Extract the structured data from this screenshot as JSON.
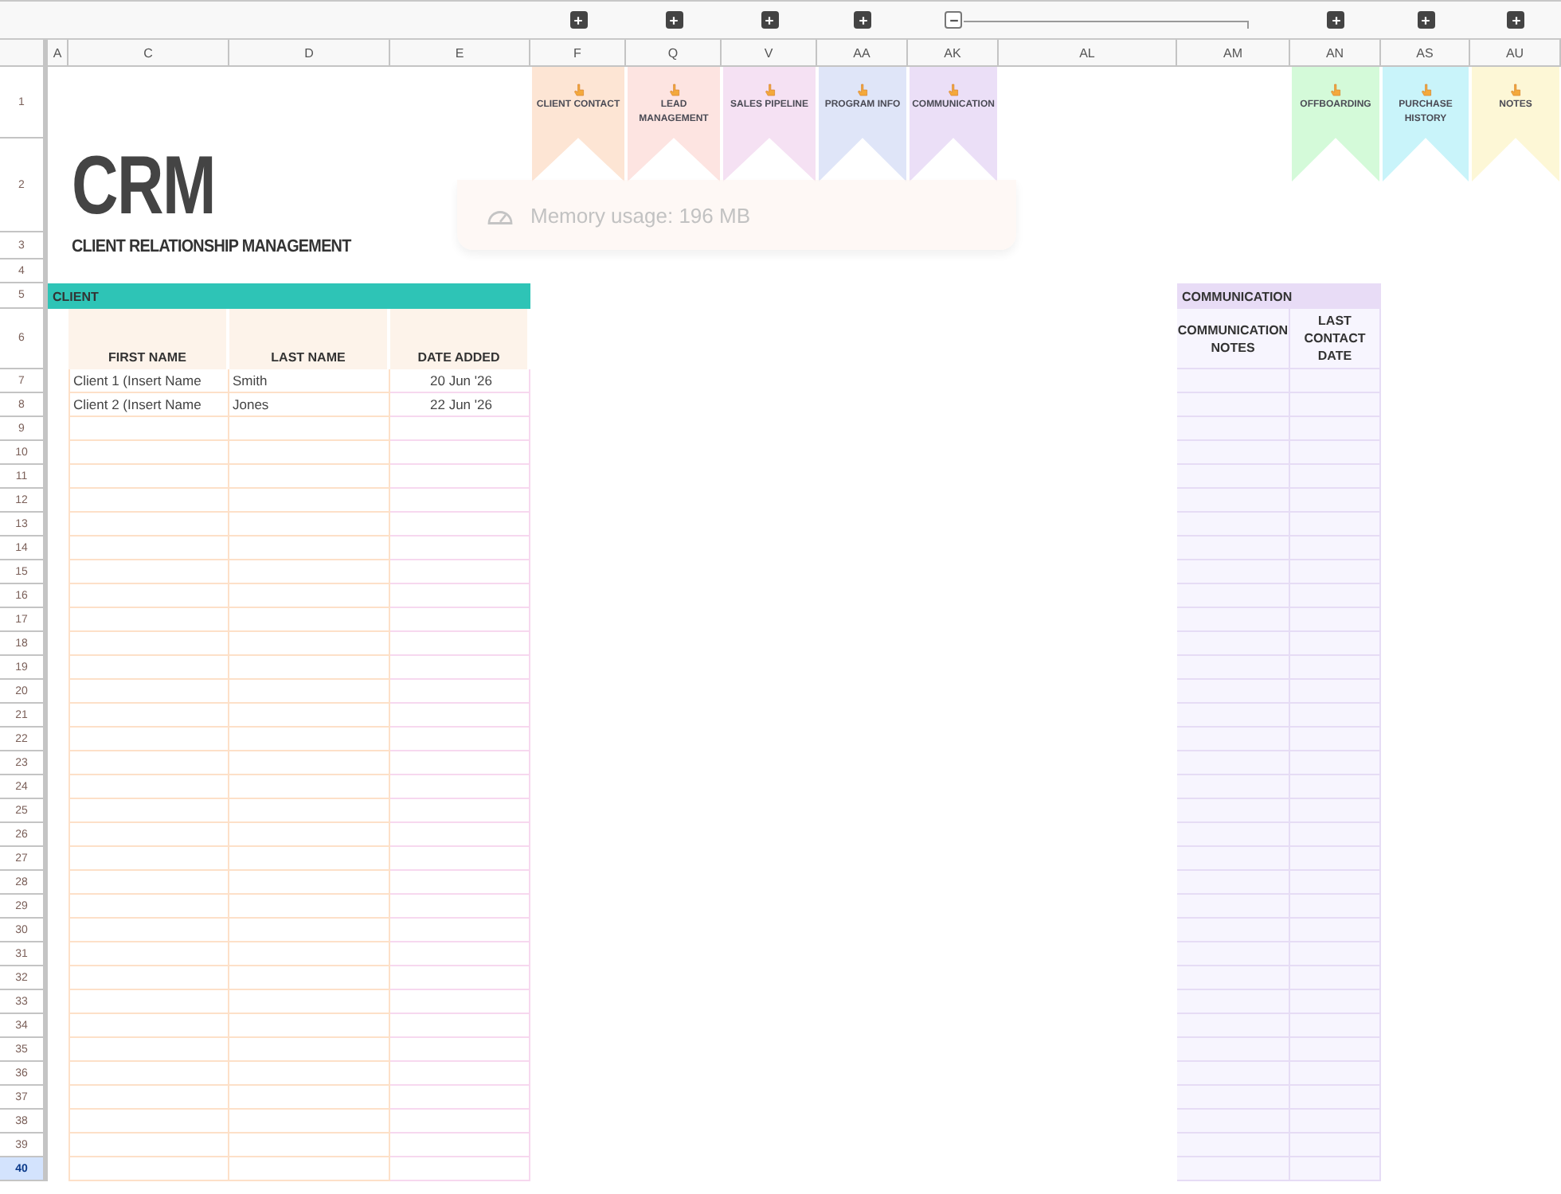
{
  "columns": [
    {
      "label": "A"
    },
    {
      "label": "C"
    },
    {
      "label": "D"
    },
    {
      "label": "E"
    },
    {
      "label": "F",
      "group": {
        "expanded": false
      },
      "banner": {
        "label": "CLIENT CONTACT",
        "color": "#fde5d4"
      }
    },
    {
      "label": "Q",
      "group": {
        "expanded": false
      },
      "banner": {
        "label": "LEAD MANAGEMENT",
        "color": "#fde4e1"
      }
    },
    {
      "label": "V",
      "group": {
        "expanded": false
      },
      "banner": {
        "label": "SALES PIPELINE",
        "color": "#f5e1f3"
      }
    },
    {
      "label": "AA",
      "group": {
        "expanded": false
      },
      "banner": {
        "label": "PROGRAM INFO",
        "color": "#dfe5f8"
      }
    },
    {
      "label": "AK",
      "group": {
        "expanded": true
      },
      "banner": {
        "label": "COMMUNICATION",
        "color": "#ebdff7"
      }
    },
    {
      "label": "AL"
    },
    {
      "label": "AM"
    },
    {
      "label": "AN",
      "group": {
        "expanded": false
      },
      "banner": {
        "label": "OFFBOARDING",
        "color": "#d4fad9"
      }
    },
    {
      "label": "AS",
      "group": {
        "expanded": false
      },
      "banner": {
        "label": "PURCHASE HISTORY",
        "color": "#c9f4fa"
      }
    },
    {
      "label": "AU",
      "group": {
        "expanded": false
      },
      "banner": {
        "label": "NOTES",
        "color": "#fdf7d6"
      }
    }
  ],
  "row_headers": [
    {
      "label": "1",
      "selected": false
    },
    {
      "label": "2",
      "selected": false
    },
    {
      "label": "3",
      "selected": false
    },
    {
      "label": "4",
      "selected": false
    },
    {
      "label": "5",
      "selected": false
    },
    {
      "label": "6",
      "selected": false
    },
    {
      "label": "7",
      "selected": false
    },
    {
      "label": "8",
      "selected": false
    },
    {
      "label": "9",
      "selected": false
    },
    {
      "label": "10",
      "selected": false
    },
    {
      "label": "11",
      "selected": false
    },
    {
      "label": "12",
      "selected": false
    },
    {
      "label": "13",
      "selected": false
    },
    {
      "label": "14",
      "selected": false
    },
    {
      "label": "15",
      "selected": false
    },
    {
      "label": "16",
      "selected": false
    },
    {
      "label": "17",
      "selected": false
    },
    {
      "label": "18",
      "selected": false
    },
    {
      "label": "19",
      "selected": false
    },
    {
      "label": "20",
      "selected": false
    },
    {
      "label": "21",
      "selected": false
    },
    {
      "label": "22",
      "selected": false
    },
    {
      "label": "23",
      "selected": false
    },
    {
      "label": "24",
      "selected": false
    },
    {
      "label": "25",
      "selected": false
    },
    {
      "label": "26",
      "selected": false
    },
    {
      "label": "27",
      "selected": false
    },
    {
      "label": "28",
      "selected": false
    },
    {
      "label": "29",
      "selected": false
    },
    {
      "label": "30",
      "selected": false
    },
    {
      "label": "31",
      "selected": false
    },
    {
      "label": "32",
      "selected": false
    },
    {
      "label": "33",
      "selected": false
    },
    {
      "label": "34",
      "selected": false
    },
    {
      "label": "35",
      "selected": false
    },
    {
      "label": "36",
      "selected": false
    },
    {
      "label": "37",
      "selected": false
    },
    {
      "label": "38",
      "selected": false
    },
    {
      "label": "39",
      "selected": false
    },
    {
      "label": "40",
      "selected": true
    }
  ],
  "title": "CRM",
  "subtitle": "CLIENT RELATIONSHIP MANAGEMENT",
  "client_table": {
    "title": "CLIENT",
    "columns": [
      "FIRST NAME",
      "LAST NAME",
      "DATE ADDED"
    ],
    "rows": [
      [
        "Client 1 (Insert Name",
        "Smith",
        "20 Jun '26"
      ],
      [
        "Client 2 (Insert Name",
        "Jones",
        "22 Jun '26"
      ]
    ]
  },
  "communication_table": {
    "title": "COMMUNICATION",
    "columns": [
      "COMMUNICATION NOTES",
      "LAST CONTACT DATE"
    ]
  },
  "memory_popup": {
    "text": "Memory usage: 196 MB"
  }
}
